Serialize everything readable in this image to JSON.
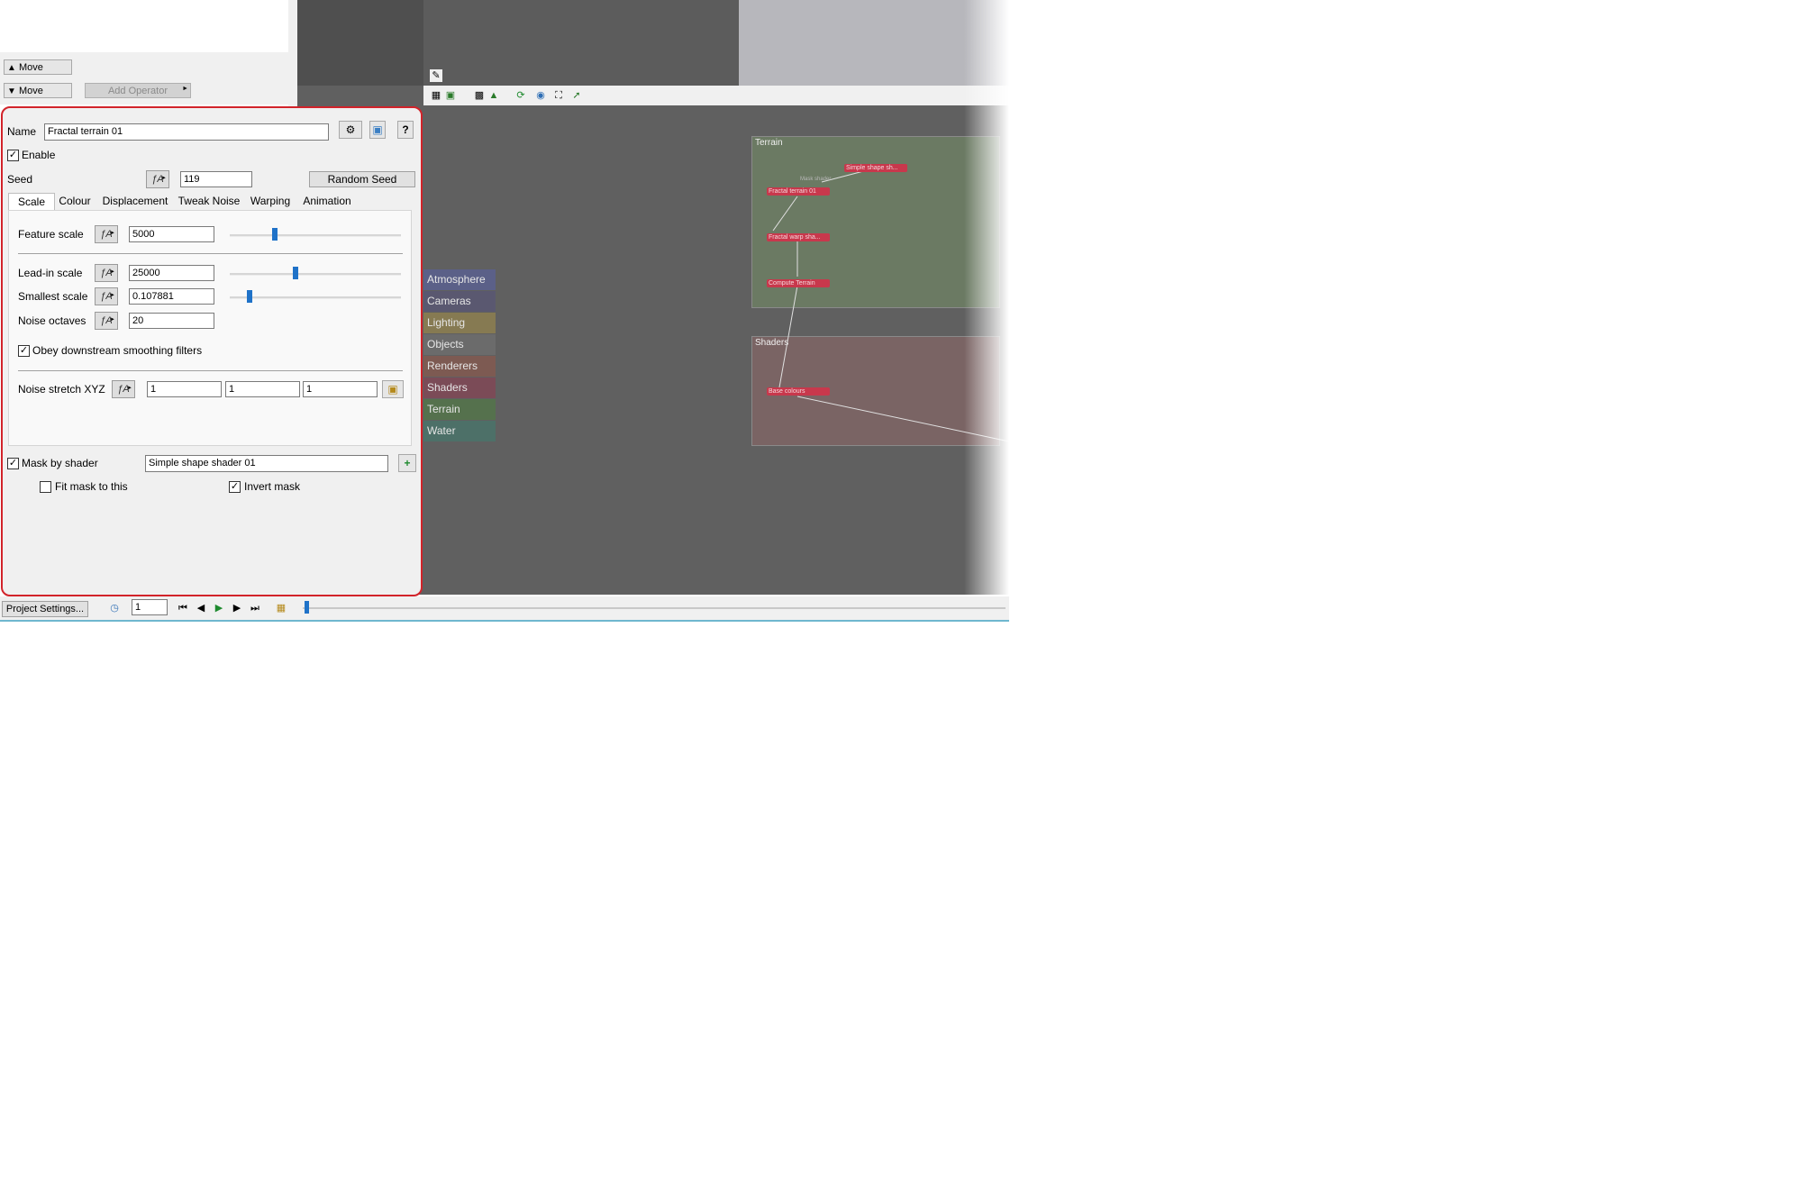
{
  "operators": {
    "move_up_label": "Move",
    "move_down_label": "Move",
    "add_operator_label": "Add Operator"
  },
  "properties": {
    "name_label": "Name",
    "name_value": "Fractal terrain 01",
    "enable_label": "Enable",
    "seed_label": "Seed",
    "seed_value": "119",
    "random_seed_label": "Random Seed",
    "tabs": [
      "Scale",
      "Colour",
      "Displacement",
      "Tweak Noise",
      "Warping",
      "Animation"
    ],
    "active_tab": "Scale",
    "scale": {
      "feature_scale_label": "Feature scale",
      "feature_scale_value": "5000",
      "lead_in_scale_label": "Lead-in scale",
      "lead_in_scale_value": "25000",
      "smallest_scale_label": "Smallest scale",
      "smallest_scale_value": "0.107881",
      "noise_octaves_label": "Noise octaves",
      "noise_octaves_value": "20",
      "obey_label": "Obey downstream smoothing filters",
      "obey_checked": true,
      "noise_stretch_label": "Noise stretch XYZ",
      "stretch_x": "1",
      "stretch_y": "1",
      "stretch_z": "1"
    },
    "mask_by_shader_label": "Mask by shader",
    "mask_by_shader_checked": true,
    "mask_shader_value": "Simple shape shader 01",
    "fit_mask_label": "Fit mask to this",
    "fit_mask_checked": false,
    "invert_mask_label": "Invert mask",
    "invert_mask_checked": true,
    "enable_checked": true
  },
  "node_view": {
    "categories": [
      {
        "label": "Atmosphere",
        "color": "#5b6088"
      },
      {
        "label": "Cameras",
        "color": "#5a5870"
      },
      {
        "label": "Lighting",
        "color": "#867a52"
      },
      {
        "label": "Objects",
        "color": "#6b6b6b"
      },
      {
        "label": "Renderers",
        "color": "#7d5a52"
      },
      {
        "label": "Shaders",
        "color": "#7b4b57"
      },
      {
        "label": "Terrain",
        "color": "#55714d"
      },
      {
        "label": "Water",
        "color": "#4d7068"
      }
    ],
    "groups": {
      "terrain_label": "Terrain",
      "shaders_label": "Shaders"
    },
    "nodes": {
      "simple_shape": "Simple shape sh...",
      "mask_shader": "Mask shader",
      "fractal_terrain": "Fractal terrain 01",
      "fractal_warp": "Fractal warp sha...",
      "compute_terrain": "Compute Terrain",
      "base_colours": "Base colours"
    }
  },
  "bottom": {
    "project_settings_label": "Project Settings...",
    "frame_value": "1"
  }
}
